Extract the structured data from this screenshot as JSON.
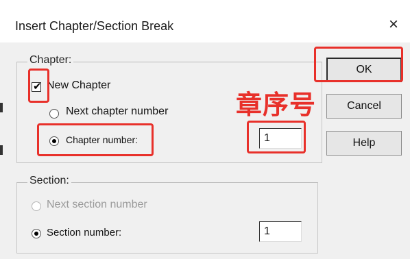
{
  "dialog": {
    "title": "Insert Chapter/Section Break",
    "close_glyph": "×"
  },
  "chapter_group": {
    "legend": "Chapter:",
    "new_chapter_label": "New Chapter",
    "new_chapter_checked": true,
    "next_chapter_label": "Next chapter number",
    "chapter_number_label": "Chapter number:",
    "chapter_number_value": "1",
    "selected_option": "chapter_number"
  },
  "section_group": {
    "legend": "Section:",
    "next_section_label": "Next section number",
    "section_number_label": "Section number:",
    "section_number_value": "1",
    "selected_option": "section_number"
  },
  "buttons": {
    "ok": "OK",
    "cancel": "Cancel",
    "help": "Help"
  },
  "annotation": {
    "text": "章序号",
    "color": "#e8302a"
  }
}
